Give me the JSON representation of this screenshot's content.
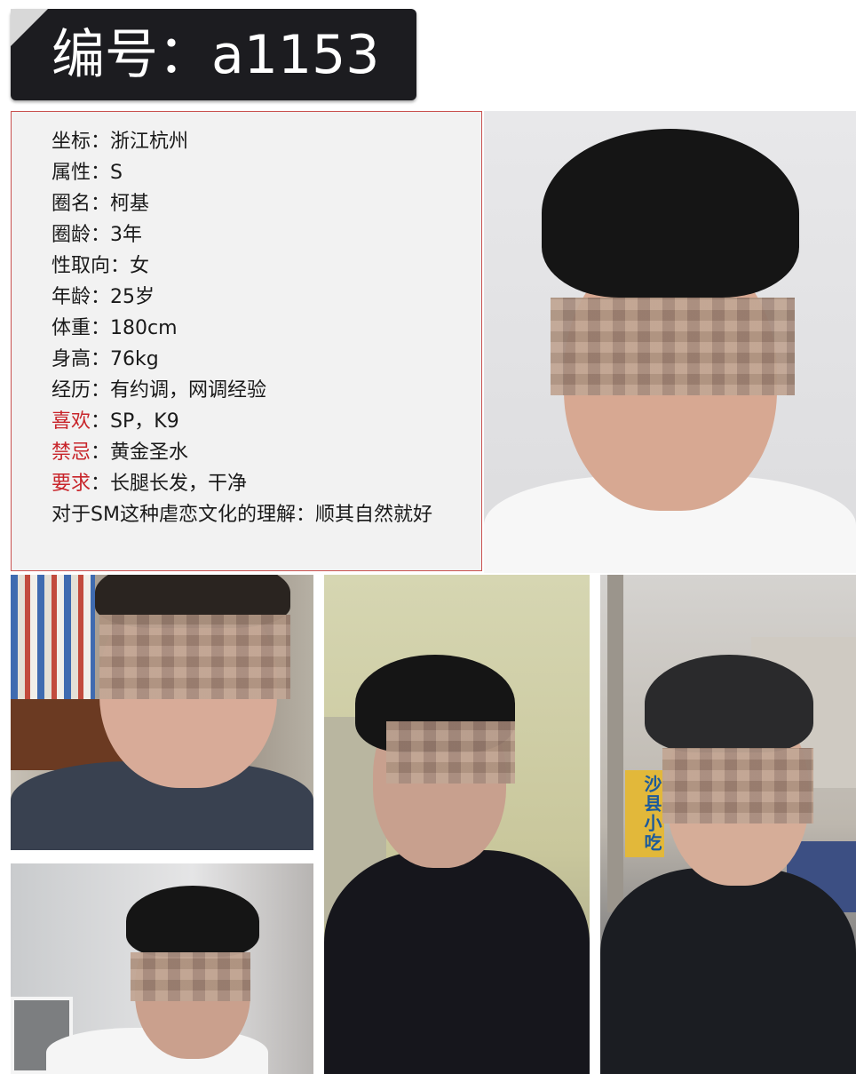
{
  "header": {
    "title": "编号：a1153"
  },
  "profile": {
    "lines": [
      {
        "key": "坐标",
        "sep": "：",
        "value": "浙江杭州",
        "highlight": false
      },
      {
        "key": "属性",
        "sep": "：",
        "value": "S",
        "highlight": false
      },
      {
        "key": "圈名",
        "sep": "：",
        "value": "柯基",
        "highlight": false
      },
      {
        "key": "圈龄",
        "sep": "：",
        "value": "3年",
        "highlight": false
      },
      {
        "key": "性取向",
        "sep": "：",
        "value": "女",
        "highlight": false
      },
      {
        "key": "年龄",
        "sep": "：",
        "value": "25岁",
        "highlight": false
      },
      {
        "key": "体重",
        "sep": "：",
        "value": "180cm",
        "highlight": false
      },
      {
        "key": "身高",
        "sep": "：",
        "value": "76kg",
        "highlight": false
      },
      {
        "key": "经历",
        "sep": "：",
        "value": "有约调，网调经验",
        "highlight": false
      },
      {
        "key": "喜欢",
        "sep": "：",
        "value": "SP，K9",
        "highlight": true
      },
      {
        "key": "禁忌",
        "sep": "：",
        "value": "黄金圣水",
        "highlight": true
      },
      {
        "key": "要求",
        "sep": "：",
        "value": "长腿长发，干净",
        "highlight": true
      },
      {
        "key": "对于SM这种虐恋文化的理解",
        "sep": "：",
        "value": "顺其自然就好",
        "highlight": false
      }
    ]
  },
  "photos": {
    "sign_text": "沙县小吃"
  },
  "colors": {
    "title_bg": "#1c1c20",
    "card_border": "#c9514f",
    "highlight": "#c8242a"
  }
}
